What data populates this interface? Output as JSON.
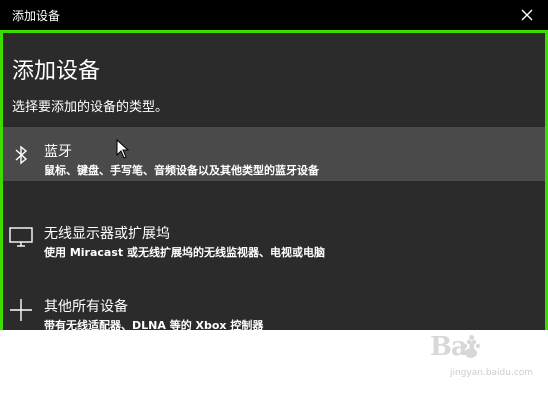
{
  "window": {
    "title": "添加设备"
  },
  "dialog": {
    "heading": "添加设备",
    "subheading": "选择要添加的设备的类型。",
    "options": [
      {
        "name": "蓝牙",
        "description": "鼠标、键盘、手写笔、音频设备以及其他类型的蓝牙设备",
        "icon": "bluetooth-icon",
        "highlighted": true
      },
      {
        "name": "无线显示器或扩展坞",
        "description": "使用 Miracast 或无线扩展坞的无线监视器、电视或电脑",
        "icon": "monitor-icon",
        "highlighted": false
      },
      {
        "name": "其他所有设备",
        "description": "带有无线适配器、DLNA 等的 Xbox 控制器",
        "icon": "plus-icon",
        "highlighted": false
      }
    ]
  },
  "watermark": {
    "brand": "Bai",
    "url": "jingyan.baidu.com"
  },
  "colors": {
    "titlebar": "#000000",
    "dialog_bg": "#2b2b2b",
    "highlight": "#4a4a4a",
    "border": "#3cdc00",
    "text": "#ffffff"
  }
}
